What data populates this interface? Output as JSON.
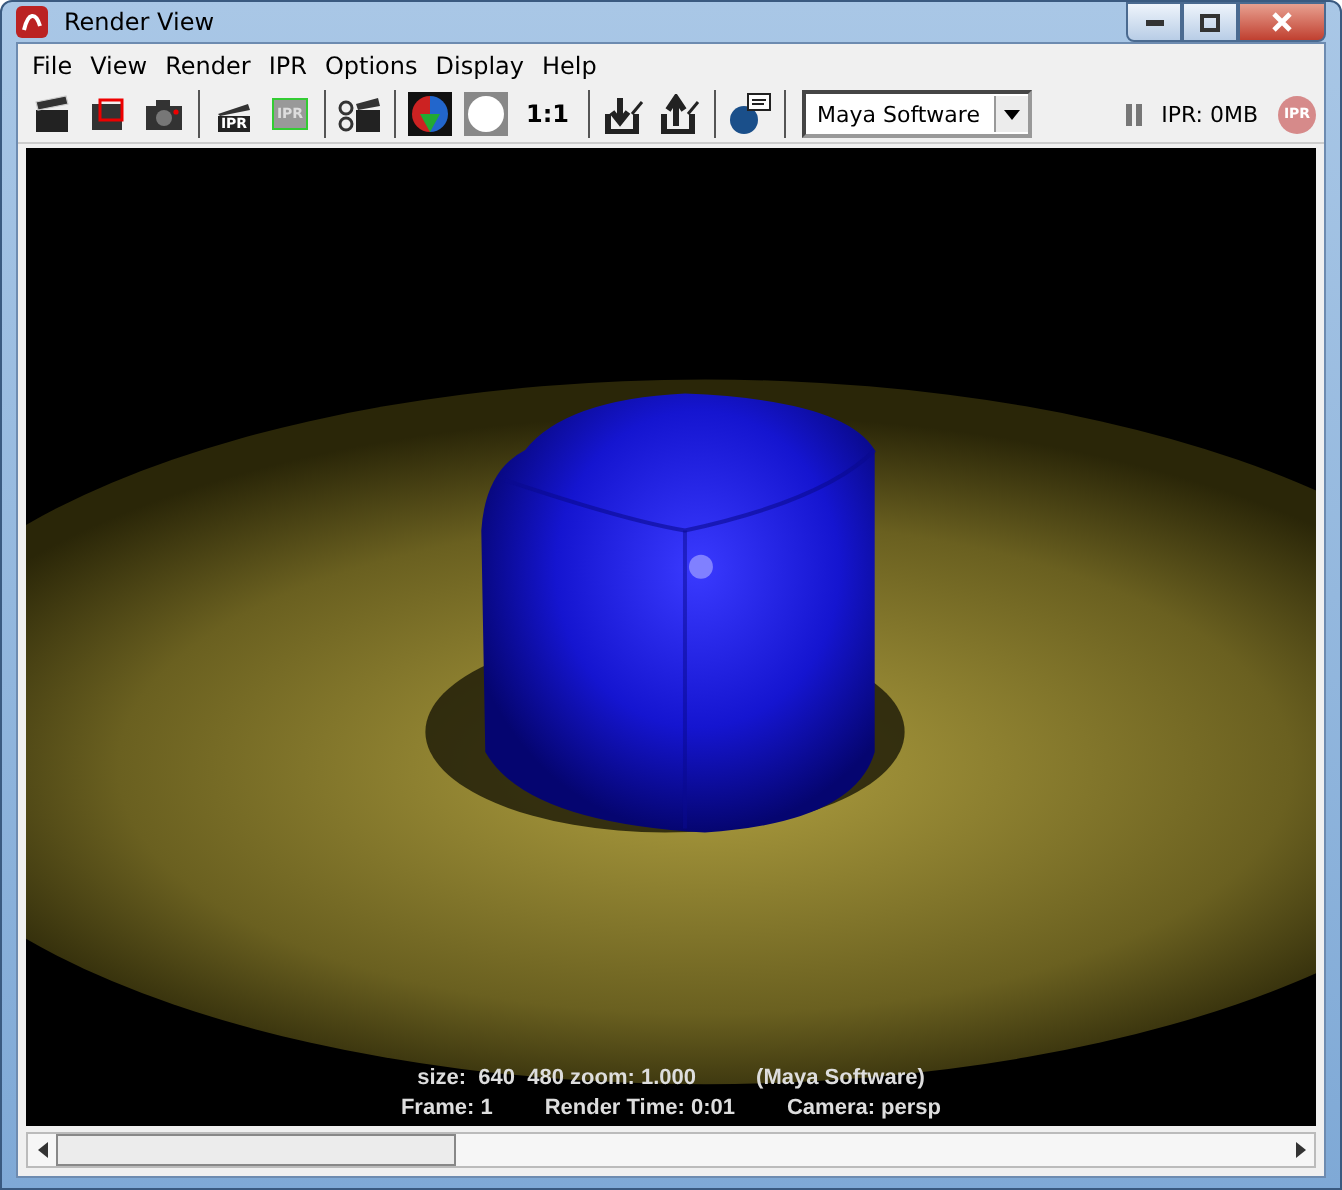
{
  "window": {
    "title": "Render View"
  },
  "menu": [
    "File",
    "View",
    "Render",
    "IPR",
    "Options",
    "Display",
    "Help"
  ],
  "toolbar": {
    "ipr_render_label": "IPR",
    "ipr_refresh_label": "IPR",
    "actual_size": "1:1",
    "renderer": "Maya Software",
    "ipr_status": "IPR: 0MB",
    "ipr_stop_label": "IPR"
  },
  "render_info": {
    "line_1": [
      "size:  640  480 zoom: 1.000",
      "(Maya Software)"
    ],
    "line_2": [
      "Frame: 1",
      "Render Time: 0:01",
      "Camera: persp"
    ]
  }
}
